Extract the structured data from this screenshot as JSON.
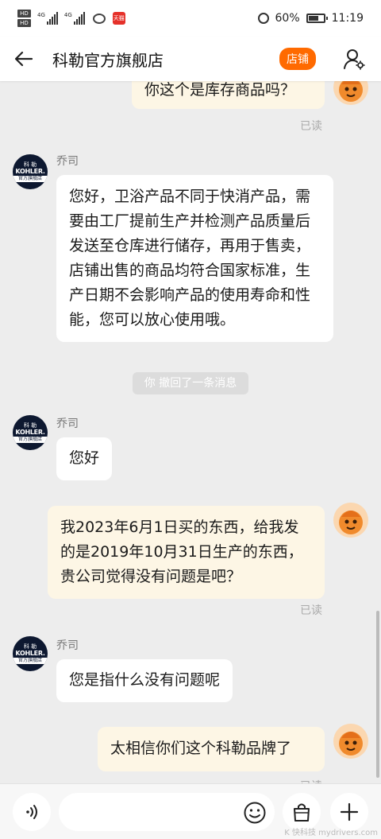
{
  "status_bar": {
    "network_badge_1": "HD 1",
    "network_badge_2": "HD 2",
    "signal_label_1": "4G",
    "signal_label_2": "4G",
    "tmall_badge": "天猫",
    "battery": "60%",
    "time": "11:19"
  },
  "header": {
    "title": "科勒官方旗舰店",
    "store_button": "店铺"
  },
  "chat": {
    "messages": [
      {
        "side": "right",
        "text": "你这个是库存商品吗？",
        "read": "已读"
      },
      {
        "side": "left",
        "sender": "乔司",
        "text": "您好，卫浴产品不同于快消产品，需要由工厂提前生产并检测产品质量后发送至仓库进行储存，再用于售卖，店铺出售的商品均符合国家标准，生产日期不会影响产品的使用寿命和性能，您可以放心使用哦。"
      },
      {
        "side": "system",
        "text": "你 撤回了一条消息"
      },
      {
        "side": "left",
        "sender": "乔司",
        "text": "您好"
      },
      {
        "side": "right",
        "text": "我2023年6月1日买的东西，给我发的是2019年10月31日生产的东西，贵公司觉得没有问题是吧？",
        "read": "已读"
      },
      {
        "side": "left",
        "sender": "乔司",
        "text": "您是指什么没有问题呢"
      },
      {
        "side": "right",
        "text": "太相信你们这个科勒品牌了",
        "read": "已读"
      }
    ],
    "kohler_avatar": {
      "line1": "科 勒",
      "line2": "KOHLER.",
      "line3": "官方旗舰店"
    }
  },
  "input_bar": {
    "placeholder": ""
  },
  "watermark": "K 快科技 mydrivers.com",
  "colors": {
    "accent": "#ff6a00",
    "left_bubble": "#ffffff",
    "right_bubble": "#fdf6e5",
    "background": "#ededed"
  },
  "icons": [
    "back-arrow-icon",
    "user-settings-icon",
    "voice-icon",
    "emoji-icon",
    "shopping-bag-icon",
    "plus-icon",
    "alarm-icon",
    "battery-icon",
    "wechat-icon"
  ]
}
